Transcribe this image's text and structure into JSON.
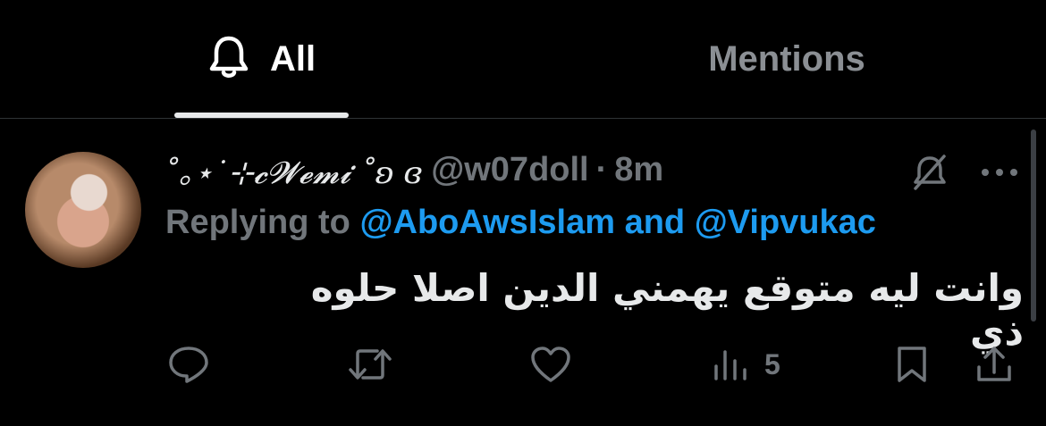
{
  "tabs": [
    {
      "label": "All",
      "icon": "bell-icon",
      "active": true
    },
    {
      "label": "Mentions",
      "active": false
    }
  ],
  "tweet": {
    "display_name": "˚｡⋆˙⊹𝓬𝓦𝓮𝓶𝓲 ˚ʚ ɞ",
    "handle": "@w07doll",
    "separator": "·",
    "time": "8m",
    "reply_prefix": "Replying to",
    "reply_user_1": "@AboAwsIslam",
    "reply_and": "and",
    "reply_user_2": "@Vipvukac",
    "text": "وانت ليه متوقع يهمني الدين اصلا حلوه ذي",
    "views": "5"
  },
  "icons": {
    "mute": "mute-icon",
    "more": "more-icon",
    "reply": "reply-icon",
    "retweet": "retweet-icon",
    "like": "heart-icon",
    "views": "views-icon",
    "bookmark": "bookmark-icon",
    "share": "share-icon"
  },
  "colors": {
    "background": "#000000",
    "text_primary": "#e7e9ea",
    "text_secondary": "#71767b",
    "link": "#1d9bf0",
    "divider": "#2f3336"
  }
}
